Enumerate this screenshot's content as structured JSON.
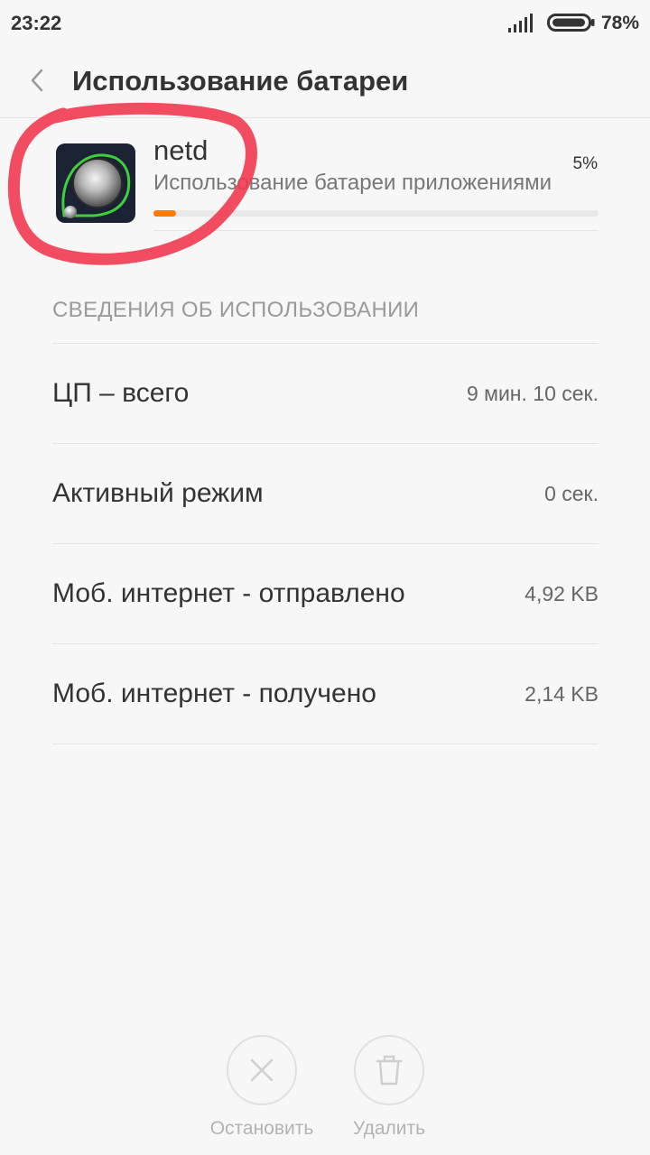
{
  "status_bar": {
    "time": "23:22",
    "battery_percent": "78%",
    "icons": [
      "signal-icon",
      "battery-icon"
    ]
  },
  "header": {
    "title": "Использование батареи",
    "back_icon": "chevron-left-icon"
  },
  "app": {
    "name": "netd",
    "subtitle": "Использование батареи приложениями",
    "percent": "5%",
    "usage_fraction": 0.05,
    "icon": "netd-app-icon",
    "accent_color": "#ff7a00"
  },
  "usage": {
    "section_title": "СВЕДЕНИЯ ОБ ИСПОЛЬЗОВАНИИ",
    "rows": [
      {
        "label": "ЦП – всего",
        "value": "9 мин. 10 сек."
      },
      {
        "label": "Активный режим",
        "value": "0 сек."
      },
      {
        "label": "Моб. интернет - отправлено",
        "value": "4,92 KB"
      },
      {
        "label": "Моб. интернет - получено",
        "value": "2,14 KB"
      }
    ]
  },
  "actions": {
    "stop": {
      "label": "Остановить",
      "icon": "close-icon"
    },
    "delete": {
      "label": "Удалить",
      "icon": "trash-icon"
    }
  },
  "annotation": {
    "color": "#f0384f"
  }
}
